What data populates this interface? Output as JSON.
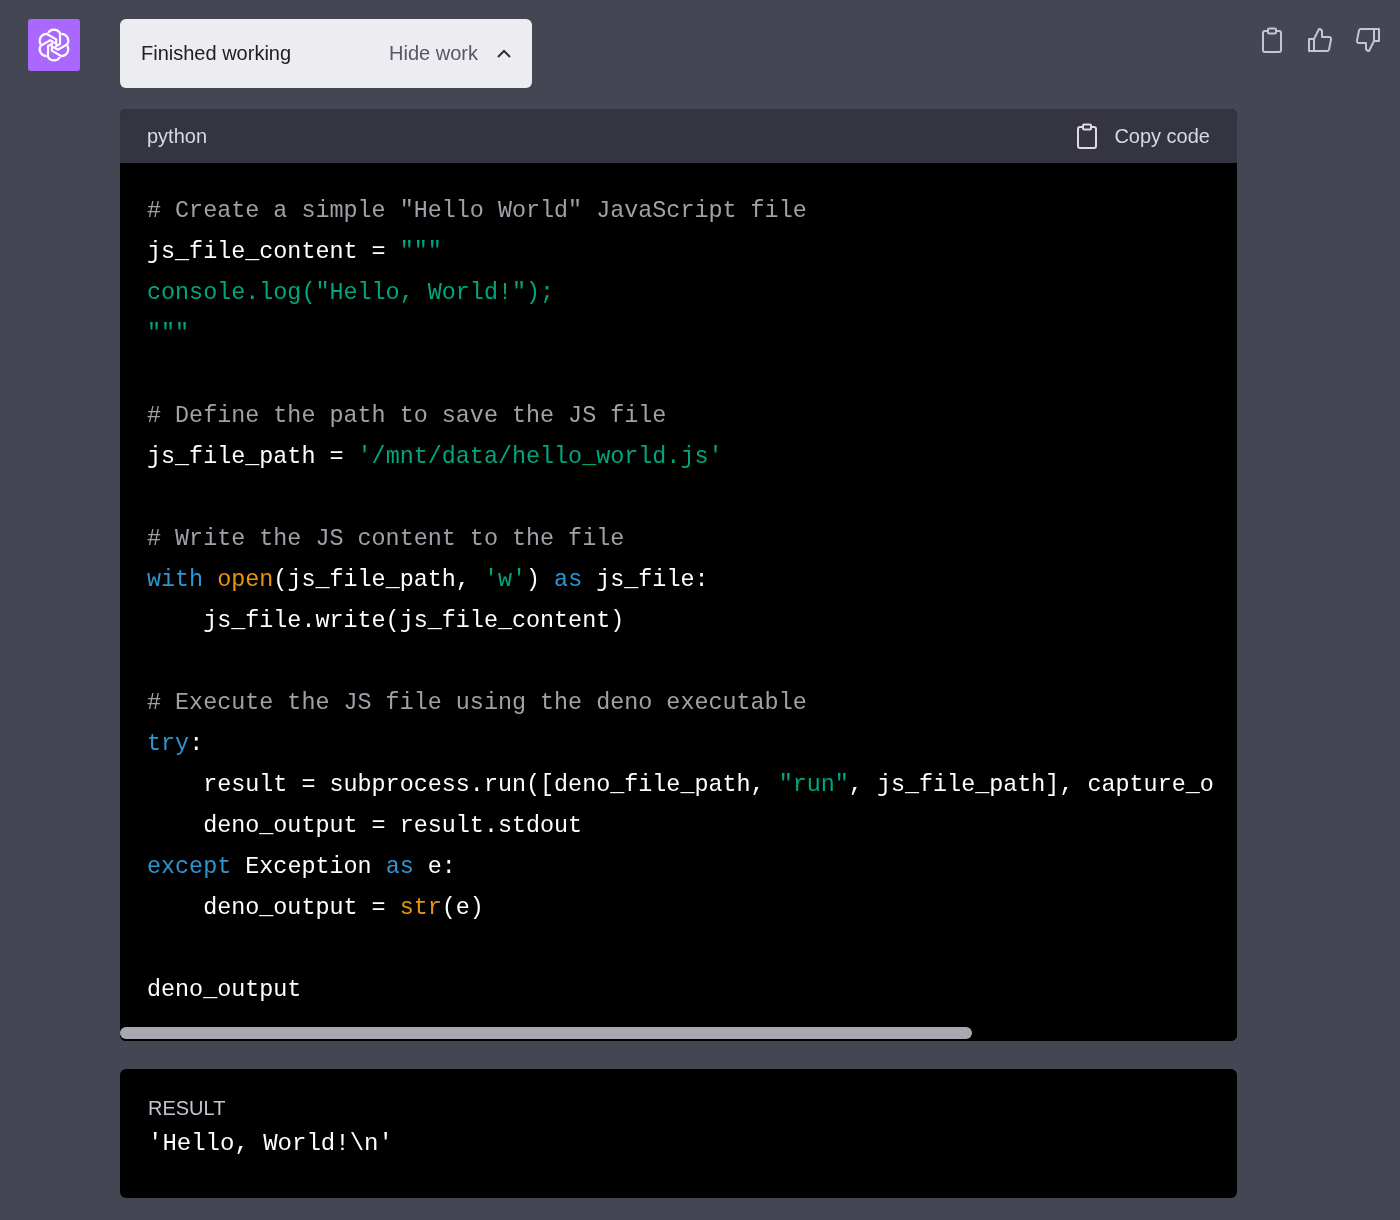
{
  "work_toggle": {
    "status": "Finished working",
    "action": "Hide work",
    "expanded": true
  },
  "code_block": {
    "language": "python",
    "copy_label": "Copy code",
    "lines": [
      {
        "kind": "code",
        "tokens": [
          {
            "kind": "comment",
            "text": "# Create a simple \"Hello World\" JavaScript file"
          }
        ]
      },
      {
        "kind": "code",
        "tokens": [
          {
            "kind": "plain",
            "text": "js_file_content = "
          },
          {
            "kind": "string",
            "text": "\"\"\""
          }
        ]
      },
      {
        "kind": "code",
        "tokens": [
          {
            "kind": "string",
            "text": "console.log(\"Hello, World!\");"
          }
        ]
      },
      {
        "kind": "code",
        "tokens": [
          {
            "kind": "string",
            "text": "\"\"\""
          }
        ]
      },
      {
        "kind": "blank"
      },
      {
        "kind": "code",
        "tokens": [
          {
            "kind": "comment",
            "text": "# Define the path to save the JS file"
          }
        ]
      },
      {
        "kind": "code",
        "tokens": [
          {
            "kind": "plain",
            "text": "js_file_path = "
          },
          {
            "kind": "string",
            "text": "'/mnt/data/hello_world.js'"
          }
        ]
      },
      {
        "kind": "blank"
      },
      {
        "kind": "code",
        "tokens": [
          {
            "kind": "comment",
            "text": "# Write the JS content to the file"
          }
        ]
      },
      {
        "kind": "code",
        "tokens": [
          {
            "kind": "keyword",
            "text": "with "
          },
          {
            "kind": "builtin",
            "text": "open"
          },
          {
            "kind": "plain",
            "text": "(js_file_path, "
          },
          {
            "kind": "string",
            "text": "'w'"
          },
          {
            "kind": "plain",
            "text": ") "
          },
          {
            "kind": "keyword",
            "text": "as"
          },
          {
            "kind": "plain",
            "text": " js_file:"
          }
        ]
      },
      {
        "kind": "code",
        "tokens": [
          {
            "kind": "plain",
            "text": "    js_file.write(js_file_content)"
          }
        ]
      },
      {
        "kind": "blank"
      },
      {
        "kind": "code",
        "tokens": [
          {
            "kind": "comment",
            "text": "# Execute the JS file using the deno executable"
          }
        ]
      },
      {
        "kind": "code",
        "tokens": [
          {
            "kind": "keyword",
            "text": "try"
          },
          {
            "kind": "plain",
            "text": ":"
          }
        ]
      },
      {
        "kind": "code",
        "tokens": [
          {
            "kind": "plain",
            "text": "    result = subprocess.run([deno_file_path, "
          },
          {
            "kind": "string",
            "text": "\"run\""
          },
          {
            "kind": "plain",
            "text": ", js_file_path], capture_o"
          }
        ]
      },
      {
        "kind": "code",
        "tokens": [
          {
            "kind": "plain",
            "text": "    deno_output = result.stdout"
          }
        ]
      },
      {
        "kind": "code",
        "tokens": [
          {
            "kind": "keyword",
            "text": "except"
          },
          {
            "kind": "plain",
            "text": " Exception "
          },
          {
            "kind": "keyword",
            "text": "as"
          },
          {
            "kind": "plain",
            "text": " e:"
          }
        ]
      },
      {
        "kind": "code",
        "tokens": [
          {
            "kind": "plain",
            "text": "    deno_output = "
          },
          {
            "kind": "builtin",
            "text": "str"
          },
          {
            "kind": "plain",
            "text": "(e)"
          }
        ]
      },
      {
        "kind": "blank"
      },
      {
        "kind": "code",
        "tokens": [
          {
            "kind": "plain",
            "text": "deno_output"
          }
        ]
      }
    ]
  },
  "result": {
    "label": "RESULT",
    "value": "'Hello, World!\\n'"
  }
}
